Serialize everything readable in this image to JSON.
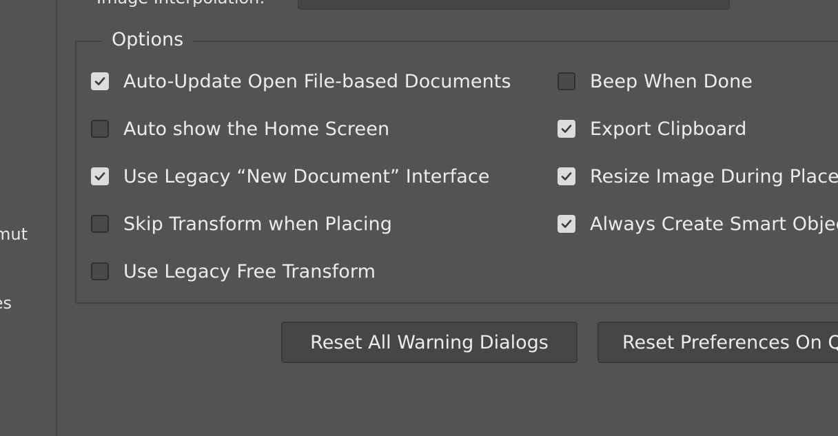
{
  "sidebar": {
    "items": [
      {
        "label": "mut"
      },
      {
        "label": "es"
      }
    ]
  },
  "top_row": {
    "label": "Image Interpolation:"
  },
  "options_group": {
    "title": "Options",
    "left_column": [
      {
        "label": "Auto-Update Open File-based Documents",
        "checked": true
      },
      {
        "label": "Auto show the Home Screen",
        "checked": false
      },
      {
        "label": "Use Legacy “New Document” Interface",
        "checked": true
      },
      {
        "label": "Skip Transform when Placing",
        "checked": false
      },
      {
        "label": "Use Legacy Free Transform",
        "checked": false
      }
    ],
    "right_column": [
      {
        "label": "Beep When Done",
        "checked": false
      },
      {
        "label": "Export Clipboard",
        "checked": true
      },
      {
        "label": "Resize Image During Place",
        "checked": true
      },
      {
        "label": "Always Create Smart Objec",
        "checked": true
      }
    ]
  },
  "buttons": {
    "reset_warnings": "Reset All Warning Dialogs",
    "reset_prefs": "Reset Preferences On Q"
  },
  "icons": {
    "check": "checkmark-icon"
  },
  "colors": {
    "background": "#535353",
    "checkbox_checked": "#dcdcdc",
    "checkmark": "#3a3a3a"
  }
}
